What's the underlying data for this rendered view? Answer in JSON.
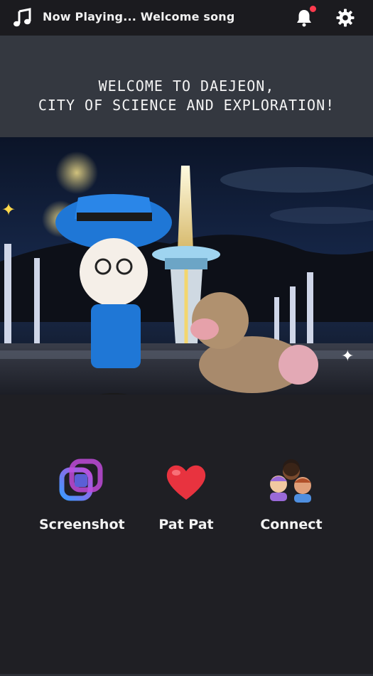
{
  "header": {
    "now_playing": "Now Playing... Welcome song",
    "icons": [
      "music-note-icon",
      "bell-icon",
      "gear-icon"
    ],
    "notification_dot_color": "#ff3b4e"
  },
  "banner": {
    "welcome_text": "WELCOME TO DAEJEON,\nCITY OF SCIENCE AND EXPLORATION!"
  },
  "actions": [
    {
      "label": "Screenshot",
      "icon": "screenshot-icon"
    },
    {
      "label": "Pat Pat",
      "icon": "heart-icon"
    },
    {
      "label": "Connect",
      "icon": "people-icon"
    }
  ],
  "colors": {
    "background": "#1f1f24",
    "topbar": "#1b1b1f",
    "banner": "#343840",
    "heart": "#e8333f",
    "screenshot_gradient_start": "#3a9bff",
    "screenshot_gradient_end": "#c04bd9"
  }
}
